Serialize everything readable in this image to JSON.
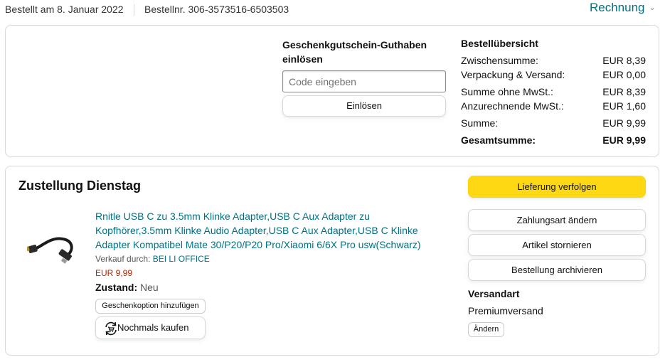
{
  "header": {
    "order_date": "Bestellt am 8. Januar 2022",
    "order_number": "Bestellnr. 306-3573516-6503503",
    "invoice_label": "Rechnung",
    "invoice_icon": "chevron-down-icon"
  },
  "voucher": {
    "title": "Geschenkgutschein-Guthaben einlösen",
    "input_placeholder": "Code eingeben",
    "input_value": "",
    "redeem_label": "Einlösen"
  },
  "summary": {
    "title": "Bestellübersicht",
    "rows": [
      {
        "label": "Zwischensumme:",
        "value": "EUR 8,39"
      },
      {
        "label": "Verpackung & Versand:",
        "value": "EUR 0,00"
      },
      {
        "label": "Summe ohne MwSt.:",
        "value": "EUR 8,39"
      },
      {
        "label": "Anzurechnende MwSt.:",
        "value": "EUR 1,60"
      },
      {
        "label": "Summe:",
        "value": "EUR 9,99"
      },
      {
        "label": "Gesamtsumme:",
        "value": "EUR 9,99"
      }
    ]
  },
  "delivery": {
    "title": "Zustellung Dienstag",
    "product": {
      "title": "Rnitle USB C zu 3.5mm Klinke Adapter,USB C Aux Adapter zu Kopfhörer,3.5mm Klinke Audio Adapter,USB C Aux Adapter,USB C Klinke Adapter Kompatibel Mate 30/P20/P20 Pro/Xiaomi 6/6X Pro usw(Schwarz)",
      "sold_by_label": "Verkauf durch:",
      "seller": "BEI LI OFFICE",
      "price": "EUR 9,99",
      "condition_label": "Zustand:",
      "condition_value": "Neu",
      "gift_option_label": "Geschenkoption hinzufügen",
      "buy_again_label": "Nochmals kaufen",
      "buy_again_icon": "repeat-cart-icon"
    },
    "actions": {
      "track": "Lieferung verfolgen",
      "change_payment": "Zahlungsart ändern",
      "cancel": "Artikel stornieren",
      "archive": "Bestellung archivieren"
    },
    "shipping": {
      "title": "Versandart",
      "method": "Premiumversand",
      "change_label": "Ändern"
    }
  },
  "colors": {
    "link": "#007185",
    "price": "#b12704",
    "primary_button": "#ffd814",
    "border": "#d5d9d9"
  }
}
